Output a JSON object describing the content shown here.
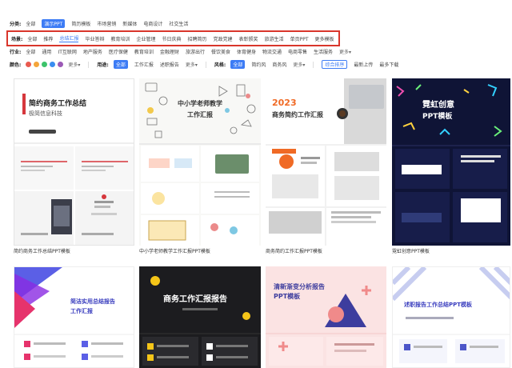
{
  "filters": {
    "category": {
      "label": "分类:",
      "items": [
        "全部",
        "演示PPT",
        "简历模板",
        "市场营销",
        "新媒体",
        "电商设计",
        "社交生活"
      ],
      "selected": 1
    },
    "scene": {
      "label": "场景:",
      "items": [
        "全部",
        "推荐",
        "总结汇报",
        "毕业答辩",
        "教育培训",
        "企业管理",
        "节日庆典",
        "招聘简历",
        "党政党建",
        "表彰颁奖",
        "旅游生活",
        "单页PPT",
        "更多模板"
      ],
      "selected": 2
    },
    "industry": {
      "label": "行业:",
      "items": [
        "全部",
        "通用",
        "IT互联网",
        "地产服务",
        "医疗保健",
        "教育培训",
        "金融理财",
        "旅游出行",
        "餐饮美食",
        "体育健身",
        "物流交通",
        "电商零售",
        "生活服务"
      ],
      "more": "更多▾"
    },
    "color_row": {
      "label": "颜色:",
      "colors": [
        "#e95a4f",
        "#f4a53a",
        "#3cc36b",
        "#3a8df0",
        "#9b59b6"
      ],
      "more": "更多▾",
      "usage_label": "用途:",
      "usage_items": [
        "全部",
        "工作汇报",
        "述职报告",
        "更多▾"
      ],
      "style_label": "风格:",
      "style_items": [
        "全部",
        "简约风",
        "商务风",
        "更多▾"
      ],
      "sort_items": [
        "综合排序",
        "最新上传",
        "最多下载"
      ]
    }
  },
  "templates_row1": [
    {
      "caption": "简约商务工作总结PPT模板",
      "title": "简约商务工作总结",
      "subtitle": "极简信息科技"
    },
    {
      "caption": "中小学老师教学工作汇报PPT模板",
      "title": "中小学老师教学",
      "subtitle": "工作汇报"
    },
    {
      "caption": "商务简约工作汇报PPT模板",
      "year": "2023",
      "title": "商务简约工作汇报"
    },
    {
      "caption": "霓虹创意PPT模板",
      "title": "霓虹创意",
      "subtitle": "PPT模板"
    }
  ],
  "templates_row2": [
    {
      "title": "简洁实用总结报告",
      "subtitle": "工作汇报"
    },
    {
      "title": "商务工作汇报报告"
    },
    {
      "title": "清新渐变分析报告",
      "subtitle": "PPT模板"
    },
    {
      "title": "述职报告工作总结PPT模板"
    }
  ]
}
